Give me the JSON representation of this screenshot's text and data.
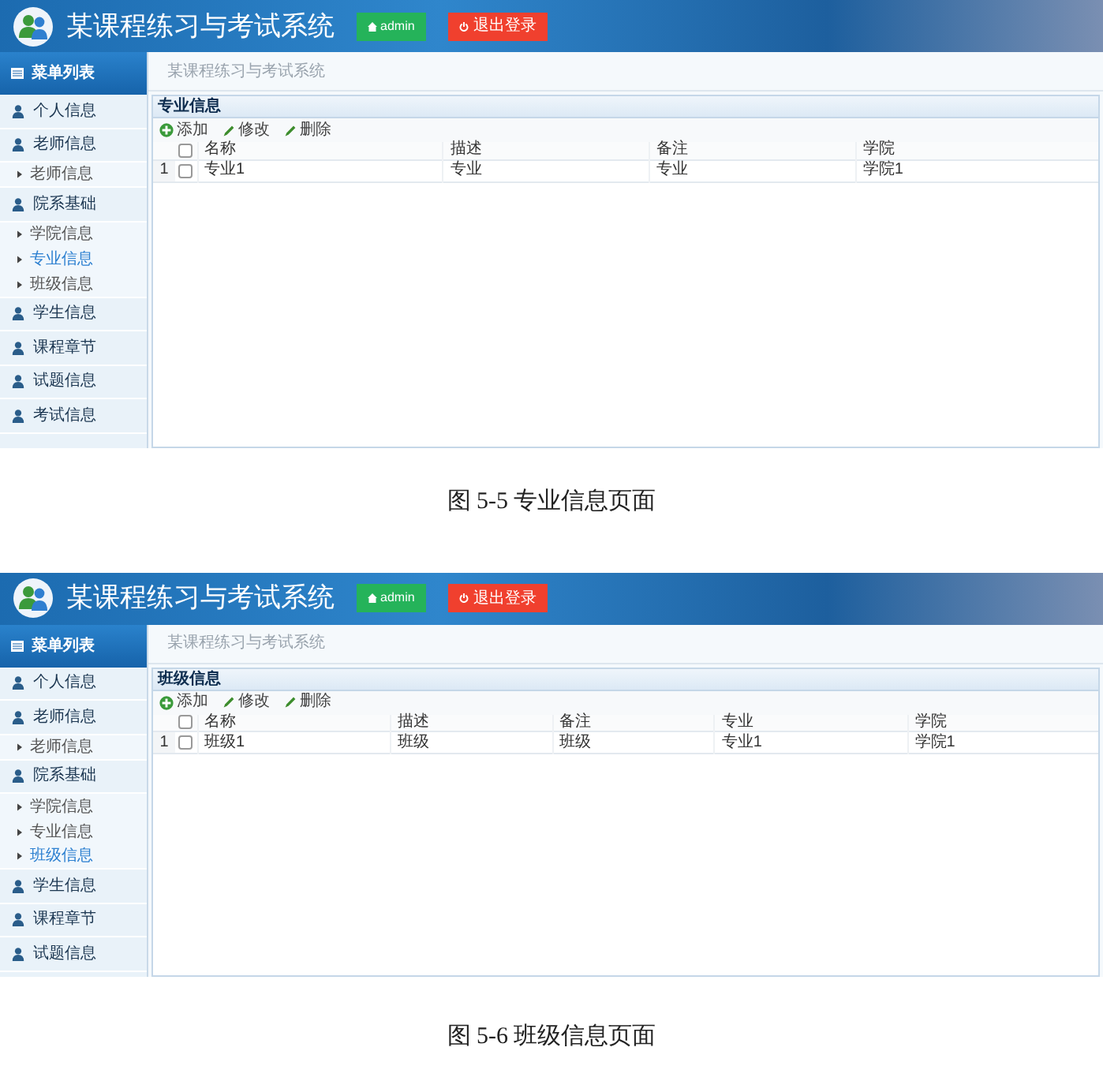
{
  "figures": [
    {
      "app": {
        "title": "某课程练习与考试系统",
        "user_button": "admin",
        "logout_button": "退出登录"
      },
      "sidebar": {
        "heading": "菜单列表",
        "items": [
          {
            "kind": "group",
            "label": "个人信息",
            "selected": false
          },
          {
            "kind": "group",
            "label": "老师信息",
            "selected": false
          },
          {
            "kind": "sub",
            "label": "老师信息",
            "selected": false
          },
          {
            "kind": "group",
            "label": "院系基础",
            "selected": false
          },
          {
            "kind": "sub",
            "label": "学院信息",
            "selected": false
          },
          {
            "kind": "sub",
            "label": "专业信息",
            "selected": true
          },
          {
            "kind": "sub",
            "label": "班级信息",
            "selected": false
          },
          {
            "kind": "group",
            "label": "学生信息",
            "selected": false
          },
          {
            "kind": "group",
            "label": "课程章节",
            "selected": false
          },
          {
            "kind": "group",
            "label": "试题信息",
            "selected": false
          },
          {
            "kind": "group",
            "label": "考试信息",
            "selected": false
          }
        ]
      },
      "breadcrumb": "某课程练习与考试系统",
      "panel": {
        "title": "专业信息",
        "all_checked": false,
        "toolbar": [
          {
            "kind": "add",
            "label": "添加"
          },
          {
            "kind": "edit",
            "label": "修改"
          },
          {
            "kind": "edit",
            "label": "删除"
          }
        ],
        "columns": [
          "名称",
          "描述",
          "备注",
          "学院"
        ],
        "rows": [
          {
            "index": "1",
            "checked": false,
            "cells": [
              "专业1",
              "专业",
              "专业",
              "学院1"
            ]
          }
        ]
      },
      "caption": "图 5-5 专业信息页面"
    },
    {
      "app": {
        "title": "某课程练习与考试系统",
        "user_button": "admin",
        "logout_button": "退出登录"
      },
      "sidebar": {
        "heading": "菜单列表",
        "items": [
          {
            "kind": "group",
            "label": "个人信息",
            "selected": false
          },
          {
            "kind": "group",
            "label": "老师信息",
            "selected": false
          },
          {
            "kind": "sub",
            "label": "老师信息",
            "selected": false
          },
          {
            "kind": "group",
            "label": "院系基础",
            "selected": false
          },
          {
            "kind": "sub",
            "label": "学院信息",
            "selected": false
          },
          {
            "kind": "sub",
            "label": "专业信息",
            "selected": false
          },
          {
            "kind": "sub",
            "label": "班级信息",
            "selected": true
          },
          {
            "kind": "group",
            "label": "学生信息",
            "selected": false
          },
          {
            "kind": "group",
            "label": "课程章节",
            "selected": false
          },
          {
            "kind": "group",
            "label": "试题信息",
            "selected": false
          }
        ]
      },
      "breadcrumb": "某课程练习与考试系统",
      "panel": {
        "title": "班级信息",
        "all_checked": false,
        "toolbar": [
          {
            "kind": "add",
            "label": "添加"
          },
          {
            "kind": "edit",
            "label": "修改"
          },
          {
            "kind": "edit",
            "label": "删除"
          }
        ],
        "columns": [
          "名称",
          "描述",
          "备注",
          "专业",
          "学院"
        ],
        "rows": [
          {
            "index": "1",
            "checked": false,
            "cells": [
              "班级1",
              "班级",
              "班级",
              "专业1",
              "学院1"
            ]
          }
        ]
      },
      "caption": "图 5-6 班级信息页面"
    }
  ]
}
